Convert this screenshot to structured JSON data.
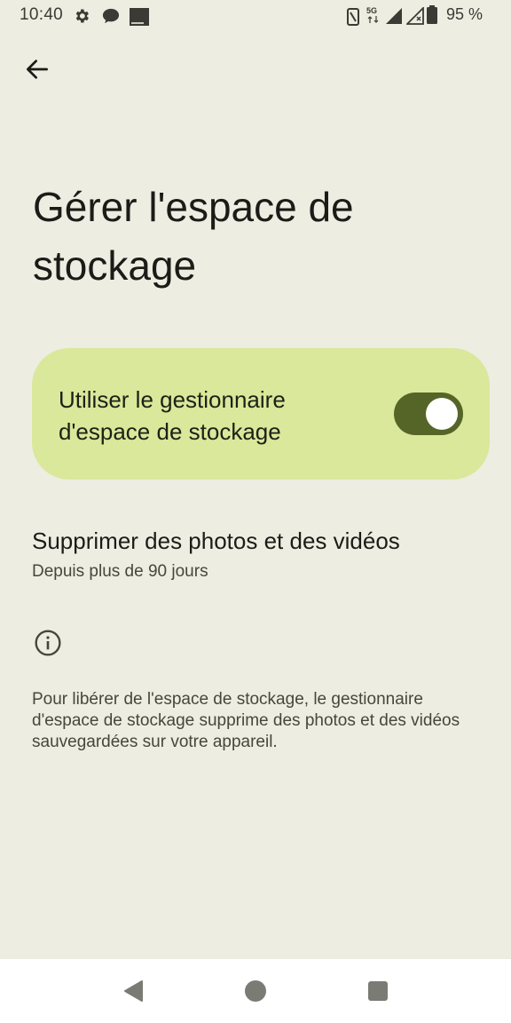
{
  "status_bar": {
    "time": "10:40",
    "battery": "95 %",
    "icons": [
      "settings-icon",
      "chat-icon",
      "orange-app-icon",
      "nfc-icon",
      "5g-icon",
      "signal-icon",
      "signal-icon-2",
      "battery-icon"
    ]
  },
  "header": {
    "back_icon": "arrow-back-icon",
    "title": "Gérer l'espace de stockage"
  },
  "toggle_card": {
    "label": "Utiliser le gestionnaire d'espace de stockage",
    "enabled": true
  },
  "delete_setting": {
    "title": "Supprimer des photos et des vidéos",
    "subtitle": "Depuis plus de 90 jours"
  },
  "info": {
    "icon": "info-icon",
    "text": "Pour libérer de l'espace de stockage, le gestionnaire d'espace de stockage supprime des photos et des vidéos sauvegardées sur votre appareil."
  },
  "colors": {
    "background": "#eeede2",
    "card": "#d9e89a",
    "switch_track": "#556527"
  },
  "nav_bar": [
    "back-triangle-icon",
    "home-circle-icon",
    "recents-square-icon"
  ]
}
